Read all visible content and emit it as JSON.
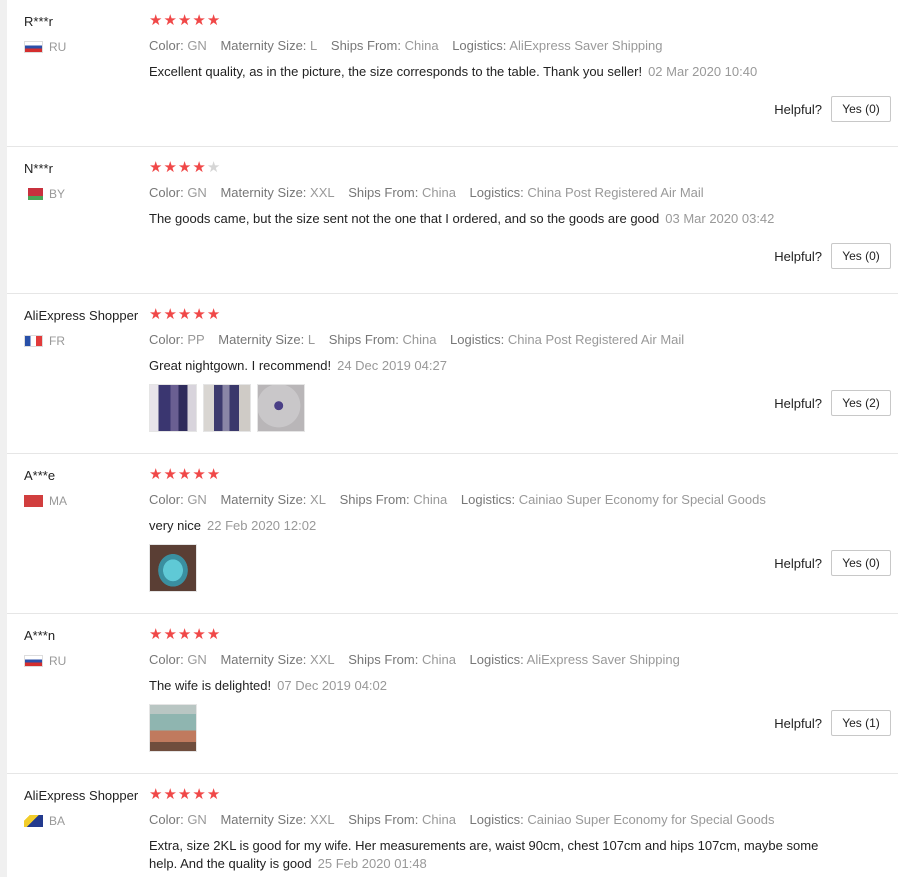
{
  "reviews": [
    {
      "user": "R***r",
      "country": "RU",
      "rating": 5,
      "props": [
        {
          "key": "Color:",
          "value": "GN"
        },
        {
          "key": "Maternity Size:",
          "value": "L"
        },
        {
          "key": "Ships From:",
          "value": "China"
        },
        {
          "key": "Logistics:",
          "value": "AliExpress Saver Shipping"
        }
      ],
      "text": "Excellent quality, as in the picture, the size corresponds to the table. Thank you seller!",
      "date": "02 Mar 2020 10:40",
      "helpful_label": "Helpful?",
      "yes_label": "Yes (0)"
    },
    {
      "user": "N***r",
      "country": "BY",
      "rating": 4,
      "props": [
        {
          "key": "Color:",
          "value": "GN"
        },
        {
          "key": "Maternity Size:",
          "value": "XXL"
        },
        {
          "key": "Ships From:",
          "value": "China"
        },
        {
          "key": "Logistics:",
          "value": "China Post Registered Air Mail"
        }
      ],
      "text": "The goods came, but the size sent not the one that I ordered, and so the goods are good",
      "date": "03 Mar 2020 03:42",
      "helpful_label": "Helpful?",
      "yes_label": "Yes (0)"
    },
    {
      "user": "AliExpress Shopper",
      "country": "FR",
      "rating": 5,
      "props": [
        {
          "key": "Color:",
          "value": "PP"
        },
        {
          "key": "Maternity Size:",
          "value": "L"
        },
        {
          "key": "Ships From:",
          "value": "China"
        },
        {
          "key": "Logistics:",
          "value": "China Post Registered Air Mail"
        }
      ],
      "text": "Great nightgown. I recommend!",
      "date": "24 Dec 2019 04:27",
      "helpful_label": "Helpful?",
      "yes_label": "Yes (2)"
    },
    {
      "user": "A***e",
      "country": "MA",
      "rating": 5,
      "props": [
        {
          "key": "Color:",
          "value": "GN"
        },
        {
          "key": "Maternity Size:",
          "value": "XL"
        },
        {
          "key": "Ships From:",
          "value": "China"
        },
        {
          "key": "Logistics:",
          "value": "Cainiao Super Economy for Special Goods"
        }
      ],
      "text": "very nice",
      "date": "22 Feb 2020 12:02",
      "helpful_label": "Helpful?",
      "yes_label": "Yes (0)"
    },
    {
      "user": "A***n",
      "country": "RU",
      "rating": 5,
      "props": [
        {
          "key": "Color:",
          "value": "GN"
        },
        {
          "key": "Maternity Size:",
          "value": "XXL"
        },
        {
          "key": "Ships From:",
          "value": "China"
        },
        {
          "key": "Logistics:",
          "value": "AliExpress Saver Shipping"
        }
      ],
      "text": "The wife is delighted!",
      "date": "07 Dec 2019 04:02",
      "helpful_label": "Helpful?",
      "yes_label": "Yes (1)"
    },
    {
      "user": "AliExpress Shopper",
      "country": "BA",
      "rating": 5,
      "props": [
        {
          "key": "Color:",
          "value": "GN"
        },
        {
          "key": "Maternity Size:",
          "value": "XXL"
        },
        {
          "key": "Ships From:",
          "value": "China"
        },
        {
          "key": "Logistics:",
          "value": "Cainiao Super Economy for Special Goods"
        }
      ],
      "text": "Extra, size 2KL is good for my wife. Her measurements are, waist 90cm, chest 107cm and hips 107cm, maybe some help. And the quality is good",
      "date": "25 Feb 2020 01:48"
    }
  ],
  "colors": {
    "star": "#f04848",
    "star_empty": "#d6d6d6",
    "muted": "#999999"
  }
}
